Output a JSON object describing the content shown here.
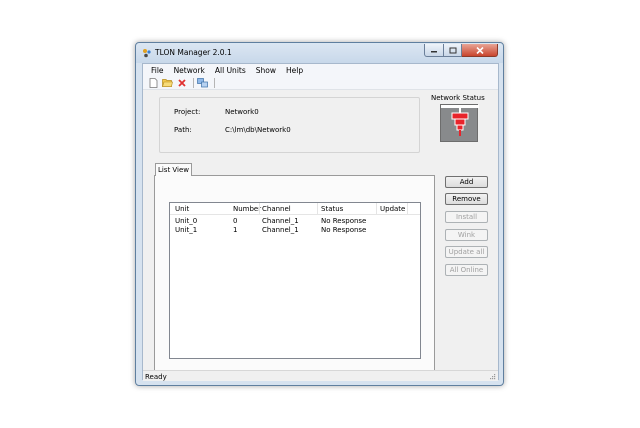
{
  "window": {
    "title": "TLON Manager 2.0.1"
  },
  "menu": [
    "File",
    "Network",
    "All Units",
    "Show",
    "Help"
  ],
  "toolbar": {
    "icons": [
      "new-file-icon",
      "open-folder-icon",
      "delete-icon",
      "connect-icon"
    ]
  },
  "project_info": {
    "project_label": "Project:",
    "project_value": "Network0",
    "path_label": "Path:",
    "path_value": "C:\\lm\\db\\Network0"
  },
  "network_status": {
    "label": "Network Status"
  },
  "tabs": [
    "List View"
  ],
  "list": {
    "columns": [
      "Unit",
      "Number",
      "Channel",
      "Status",
      "Update"
    ],
    "rows": [
      {
        "unit": "Unit_0",
        "number": "0",
        "channel": "Channel_1",
        "status": "No Response",
        "update": ""
      },
      {
        "unit": "Unit_1",
        "number": "1",
        "channel": "Channel_1",
        "status": "No Response",
        "update": ""
      }
    ]
  },
  "buttons": {
    "add": "Add",
    "remove": "Remove",
    "install": "Install",
    "wink": "Wink",
    "update_all": "Update all",
    "all_online": "All Online"
  },
  "status_bar": {
    "text": "Ready"
  },
  "colors": {
    "status_icon_red": "#e8232b",
    "status_icon_bg": "#888a8c"
  }
}
